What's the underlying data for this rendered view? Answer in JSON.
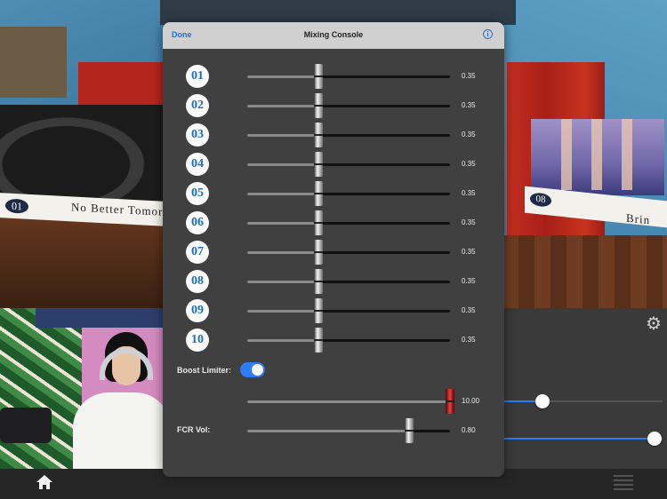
{
  "modal": {
    "done_label": "Done",
    "title": "Mixing Console",
    "info_icon": "info-icon",
    "channels": [
      {
        "label": "01",
        "value": 0.35,
        "value_text": "0.35"
      },
      {
        "label": "02",
        "value": 0.35,
        "value_text": "0.35"
      },
      {
        "label": "03",
        "value": 0.35,
        "value_text": "0.35"
      },
      {
        "label": "04",
        "value": 0.35,
        "value_text": "0.35"
      },
      {
        "label": "05",
        "value": 0.35,
        "value_text": "0.35"
      },
      {
        "label": "06",
        "value": 0.35,
        "value_text": "0.35"
      },
      {
        "label": "07",
        "value": 0.35,
        "value_text": "0.35"
      },
      {
        "label": "08",
        "value": 0.35,
        "value_text": "0.35"
      },
      {
        "label": "09",
        "value": 0.35,
        "value_text": "0.35"
      },
      {
        "label": "10",
        "value": 0.35,
        "value_text": "0.35"
      }
    ],
    "boost_limiter": {
      "label": "Boost Limiter:",
      "on": true
    },
    "boost_slider": {
      "value": 1.0,
      "value_text": "10.00"
    },
    "fcr_vol": {
      "label": "FCR Vol:",
      "value": 0.8,
      "value_text": "0.80"
    }
  },
  "background": {
    "left_banner": {
      "number": "01",
      "text": "No Better Tomor"
    },
    "right_banner": {
      "number": "08",
      "text": "Brin"
    }
  },
  "right_panel": {
    "settings_icon": "gear-icon",
    "slider_1": {
      "value": 0.24
    },
    "slider_2": {
      "value": 0.95
    }
  },
  "bottom_bar": {
    "home_icon": "home-icon",
    "list_icon": "list-icon"
  },
  "colors": {
    "accent": "#2e7cf6",
    "badge_text": "#1b6fc2",
    "red_thumb": "#b42323"
  }
}
